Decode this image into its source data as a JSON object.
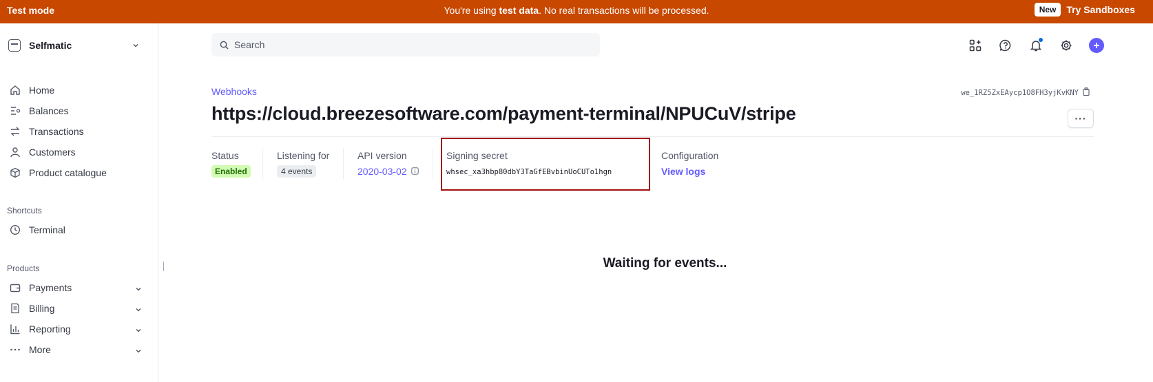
{
  "banner": {
    "mode": "Test mode",
    "msg_prefix": "You're using ",
    "msg_bold": "test data",
    "msg_suffix": ". No real transactions will be processed.",
    "new_badge": "New",
    "try_label": "Try Sandboxes",
    "color": "#c84800"
  },
  "sidebar": {
    "account_name": "Selfmatic",
    "nav": [
      {
        "label": "Home",
        "icon": "home-icon"
      },
      {
        "label": "Balances",
        "icon": "balances-icon"
      },
      {
        "label": "Transactions",
        "icon": "transactions-icon"
      },
      {
        "label": "Customers",
        "icon": "customers-icon"
      },
      {
        "label": "Product catalogue",
        "icon": "product-catalogue-icon"
      }
    ],
    "shortcuts_title": "Shortcuts",
    "shortcuts": [
      {
        "label": "Terminal",
        "icon": "clock-icon"
      }
    ],
    "products_title": "Products",
    "products": [
      {
        "label": "Payments",
        "icon": "wallet-icon"
      },
      {
        "label": "Billing",
        "icon": "billing-icon"
      },
      {
        "label": "Reporting",
        "icon": "bar-chart-icon"
      },
      {
        "label": "More",
        "icon": "more-dots-icon"
      }
    ]
  },
  "header": {
    "search_placeholder": "Search",
    "icons": [
      "apps-icon",
      "help-icon",
      "notifications-icon",
      "settings-icon",
      "create-plus-icon"
    ],
    "accent": "#635bff"
  },
  "page": {
    "breadcrumb": "Webhooks",
    "title": "https://cloud.breezesoftware.com/payment-terminal/NPUCuV/stripe",
    "endpoint_id": "we_1RZ5ZxEAycp1O8FH3yjKvKNY",
    "more_label": "···"
  },
  "details": {
    "status_label": "Status",
    "status_value": "Enabled",
    "listening_label": "Listening for",
    "listening_value": "4 events",
    "api_label": "API version",
    "api_value": "2020-03-02",
    "secret_label": "Signing secret",
    "secret_value": "whsec_xa3hbp80dbY3TaGfEBvbinUoCUTo1hgn",
    "config_label": "Configuration",
    "config_link": "View logs"
  },
  "empty_state": {
    "message": "Waiting for events..."
  }
}
